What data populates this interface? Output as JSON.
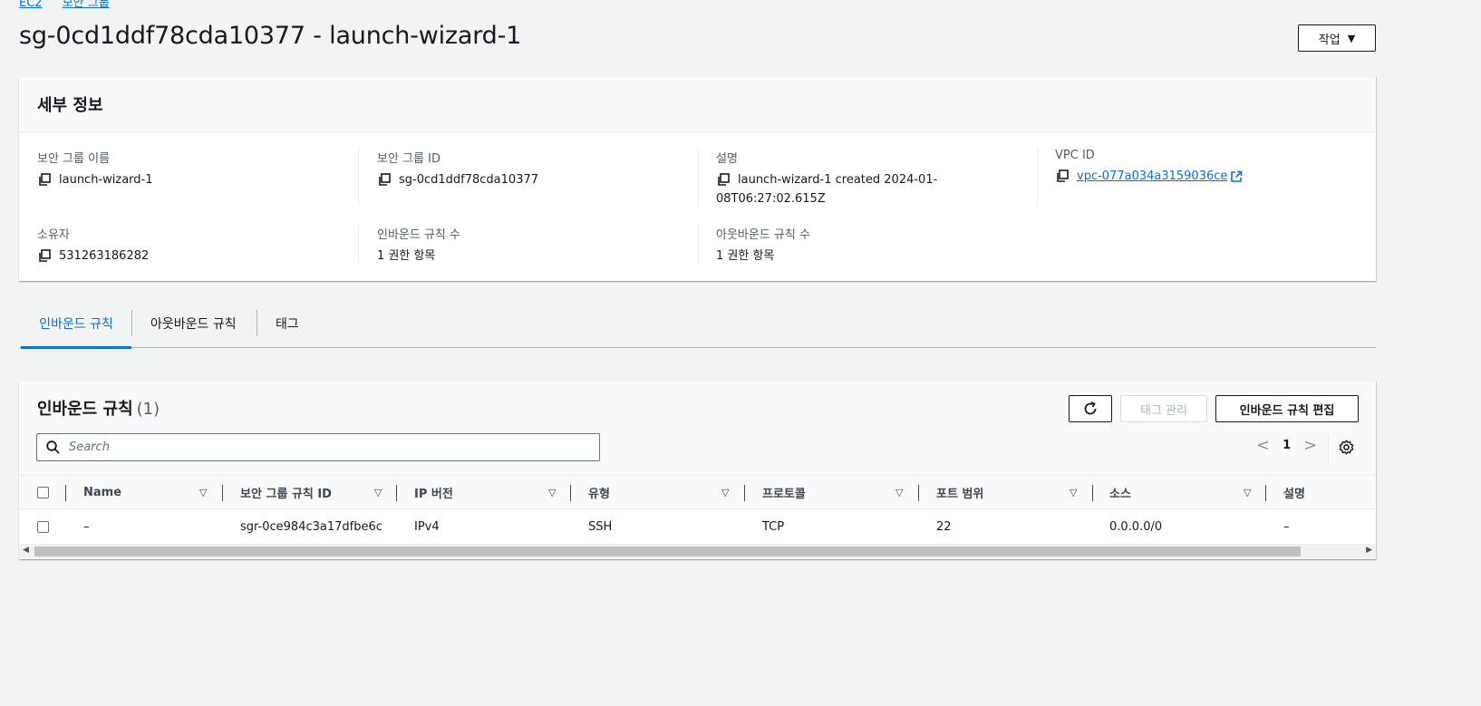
{
  "breadcrumb": [
    "EC2",
    "보안 그룹"
  ],
  "page_title": "sg-0cd1ddf78cda10377 - launch-wizard-1",
  "actions_button": "작업",
  "details": {
    "heading": "세부 정보",
    "sg_name_label": "보안 그룹 이름",
    "sg_name": "launch-wizard-1",
    "sg_id_label": "보안 그룹 ID",
    "sg_id": "sg-0cd1ddf78cda10377",
    "description_label": "설명",
    "description_line1": "launch-wizard-1 created 2024-01-",
    "description_line2": "08T06:27:02.615Z",
    "vpc_label": "VPC ID",
    "vpc_id": "vpc-077a034a3159036ce",
    "owner_label": "소유자",
    "owner": "531263186282",
    "inbound_count_label": "인바운드 규칙 수",
    "inbound_count": "1 권한 항목",
    "outbound_count_label": "아웃바운드 규칙 수",
    "outbound_count": "1 권한 항목"
  },
  "tabs": [
    "인바운드 규칙",
    "아웃바운드 규칙",
    "태그"
  ],
  "rules": {
    "title": "인바운드 규칙",
    "count": "(1)",
    "manage_tags": "태그 관리",
    "edit_rules": "인바운드 규칙 편집",
    "search_placeholder": "Search",
    "page": "1",
    "columns": [
      "Name",
      "보안 그룹 규칙 ID",
      "IP 버전",
      "유형",
      "프로토콜",
      "포트 범위",
      "소스",
      "설명"
    ],
    "rows": [
      [
        "–",
        "sgr-0ce984c3a17dfbe6c",
        "IPv4",
        "SSH",
        "TCP",
        "22",
        "0.0.0.0/0",
        "–"
      ]
    ]
  },
  "colors": {
    "link": "#0972d3",
    "background": "#f2f3f3",
    "border": "#aab7b8"
  }
}
